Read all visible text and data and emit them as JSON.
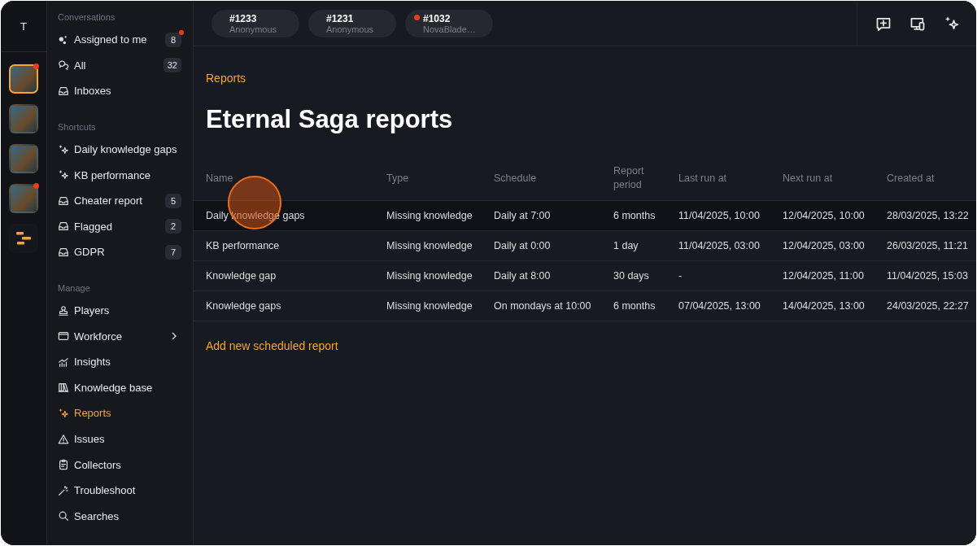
{
  "rail": {
    "initial": "T",
    "workspaces": [
      {
        "kind": "game",
        "selected": true,
        "unread": true
      },
      {
        "kind": "game",
        "selected": false,
        "unread": false
      },
      {
        "kind": "game",
        "selected": false,
        "unread": false
      },
      {
        "kind": "game",
        "selected": false,
        "unread": true
      },
      {
        "kind": "logo",
        "selected": false,
        "unread": false
      }
    ]
  },
  "sidebar": {
    "sections": [
      {
        "title": "Conversations",
        "items": [
          {
            "kind": "assigned",
            "label": "Assigned to me",
            "count": "8",
            "unread": true,
            "selected": false,
            "expandable": false
          },
          {
            "kind": "chats",
            "label": "All",
            "count": "32",
            "unread": false,
            "selected": false,
            "expandable": false
          },
          {
            "kind": "inbox",
            "label": "Inboxes",
            "selected": false,
            "expandable": false
          }
        ]
      },
      {
        "title": "Shortcuts",
        "items": [
          {
            "kind": "sparkle",
            "label": "Daily knowledge gaps",
            "selected": false,
            "expandable": false
          },
          {
            "kind": "sparkle",
            "label": "KB performance",
            "selected": false,
            "expandable": false
          },
          {
            "kind": "inbox",
            "label": "Cheater report",
            "count": "5",
            "unread": false,
            "selected": false,
            "expandable": false
          },
          {
            "kind": "inbox",
            "label": "Flagged",
            "count": "2",
            "unread": false,
            "selected": false,
            "expandable": false
          },
          {
            "kind": "inbox",
            "label": "GDPR",
            "count": "7",
            "unread": false,
            "selected": false,
            "expandable": false
          }
        ]
      },
      {
        "title": "Manage",
        "items": [
          {
            "kind": "player",
            "label": "Players",
            "selected": false,
            "expandable": false
          },
          {
            "kind": "window",
            "label": "Workforce",
            "selected": false,
            "expandable": true
          },
          {
            "kind": "chart",
            "label": "Insights",
            "selected": false,
            "expandable": false
          },
          {
            "kind": "book",
            "label": "Knowledge base",
            "selected": false,
            "expandable": false
          },
          {
            "kind": "sparkle",
            "label": "Reports",
            "selected": true,
            "expandable": false
          },
          {
            "kind": "warning",
            "label": "Issues",
            "selected": false,
            "expandable": false
          },
          {
            "kind": "clipboard",
            "label": "Collectors",
            "selected": false,
            "expandable": false
          },
          {
            "kind": "wand",
            "label": "Troubleshoot",
            "selected": false,
            "expandable": false
          },
          {
            "kind": "search",
            "label": "Searches",
            "selected": false,
            "expandable": false
          }
        ]
      }
    ]
  },
  "tabs": [
    {
      "number": "#1233",
      "name": "Anonymous",
      "unread": false
    },
    {
      "number": "#1231",
      "name": "Anonymous",
      "unread": false
    },
    {
      "number": "#1032",
      "name": "NovaBlade…",
      "unread": true
    }
  ],
  "toolbar": [
    {
      "kind": "new-chat"
    },
    {
      "kind": "devices"
    },
    {
      "kind": "sparkle"
    }
  ],
  "breadcrumb": "Reports",
  "title": "Eternal Saga reports",
  "table": {
    "columns": [
      "Name",
      "Type",
      "Schedule",
      "Report period",
      "Last run at",
      "Next run at",
      "Created at"
    ],
    "rows": [
      {
        "selected": true,
        "cells": [
          "Daily knowledge gaps",
          "Missing knowledge",
          "Daily at 7:00",
          "6 months",
          "11/04/2025, 10:00",
          "12/04/2025, 10:00",
          "28/03/2025, 13:22"
        ]
      },
      {
        "selected": false,
        "cells": [
          "KB performance",
          "Missing knowledge",
          "Daily at 0:00",
          "1 day",
          "11/04/2025, 03:00",
          "12/04/2025, 03:00",
          "26/03/2025, 11:21"
        ]
      },
      {
        "selected": false,
        "cells": [
          "Knowledge gap",
          "Missing knowledge",
          "Daily at 8:00",
          "30 days",
          "-",
          "12/04/2025, 11:00",
          "11/04/2025, 15:03"
        ]
      },
      {
        "selected": false,
        "cells": [
          "Knowledge gaps",
          "Missing knowledge",
          "On mondays at 10:00",
          "6 months",
          "07/04/2025, 13:00",
          "14/04/2025, 13:00",
          "24/03/2025, 22:27"
        ]
      }
    ]
  },
  "add_link": "Add new scheduled report"
}
